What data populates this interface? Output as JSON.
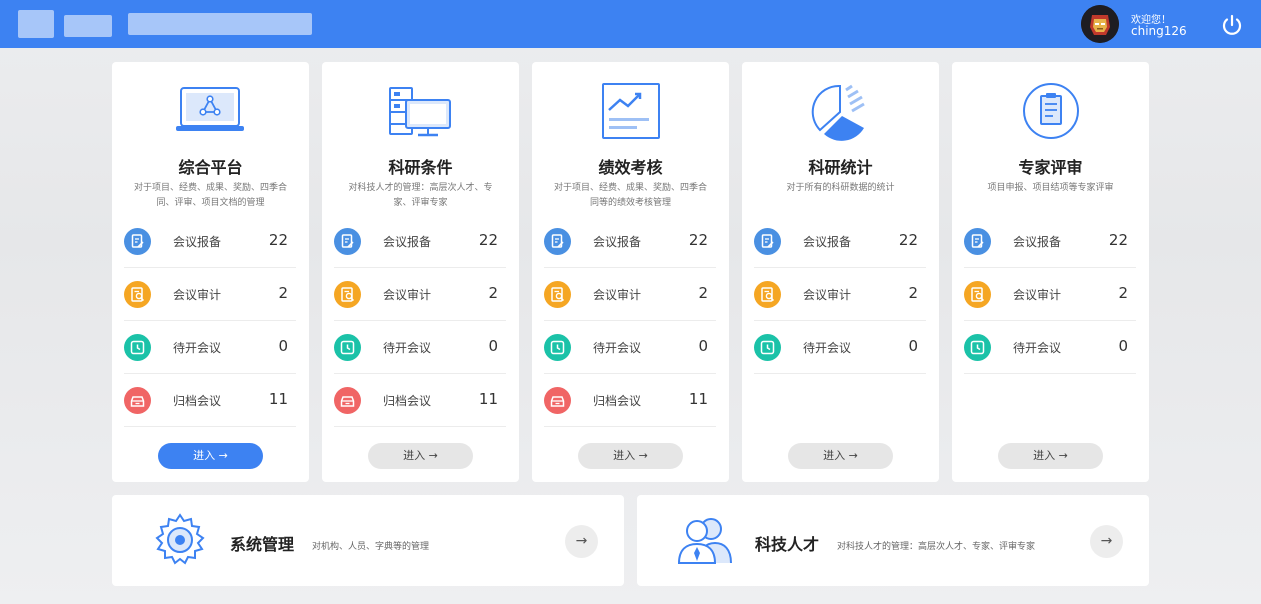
{
  "header": {
    "user": {
      "welcome": "欢迎您！",
      "username": "ching126"
    }
  },
  "icons": {
    "row_icons": [
      "edit-icon",
      "search-doc-icon",
      "clock-icon",
      "archive-icon"
    ],
    "row_colors": [
      "#4a90e2",
      "#f5a623",
      "#1bc2a8",
      "#f06565"
    ],
    "accent": "#3d82f2"
  },
  "cards": [
    {
      "title": "综合平台",
      "icon": "platform-icon",
      "desc": "对于项目、经费、成果、奖励、四季合同、评审、项目文档的管理",
      "rows": [
        {
          "label": "会议报备",
          "value": "22"
        },
        {
          "label": "会议审计",
          "value": "2"
        },
        {
          "label": "待开会议",
          "value": "0"
        },
        {
          "label": "归档会议",
          "value": "11"
        }
      ],
      "button": "进入 →",
      "active": true
    },
    {
      "title": "科研条件",
      "icon": "server-monitor-icon",
      "desc": "对科技人才的管理：高层次人才、专家、评审专家",
      "rows": [
        {
          "label": "会议报备",
          "value": "22"
        },
        {
          "label": "会议审计",
          "value": "2"
        },
        {
          "label": "待开会议",
          "value": "0"
        },
        {
          "label": "归档会议",
          "value": "11"
        }
      ],
      "button": "进入 →",
      "active": false
    },
    {
      "title": "绩效考核",
      "icon": "trend-chart-icon",
      "desc": "对于项目、经费、成果、奖励、四季合同等的绩效考核管理",
      "rows": [
        {
          "label": "会议报备",
          "value": "22"
        },
        {
          "label": "会议审计",
          "value": "2"
        },
        {
          "label": "待开会议",
          "value": "0"
        },
        {
          "label": "归档会议",
          "value": "11"
        }
      ],
      "button": "进入 →",
      "active": false
    },
    {
      "title": "科研统计",
      "icon": "pie-chart-icon",
      "desc": "对于所有的科研数据的统计",
      "rows": [
        {
          "label": "会议报备",
          "value": "22"
        },
        {
          "label": "会议审计",
          "value": "2"
        },
        {
          "label": "待开会议",
          "value": "0"
        }
      ],
      "button": "进入 →",
      "active": false
    },
    {
      "title": "专家评审",
      "icon": "clipboard-icon",
      "desc": "项目申报、项目结项等专家评审",
      "rows": [
        {
          "label": "会议报备",
          "value": "22"
        },
        {
          "label": "会议审计",
          "value": "2"
        },
        {
          "label": "待开会议",
          "value": "0"
        }
      ],
      "button": "进入 →",
      "active": false
    }
  ],
  "bottom_panels": [
    {
      "title": "系统管理",
      "desc": "对机构、人员、字典等的管理",
      "icon": "gear-icon",
      "arrow": "→"
    },
    {
      "title": "科技人才",
      "desc": "对科技人才的管理：高层次人才、专家、评审专家",
      "icon": "people-icon",
      "arrow": "→"
    }
  ]
}
